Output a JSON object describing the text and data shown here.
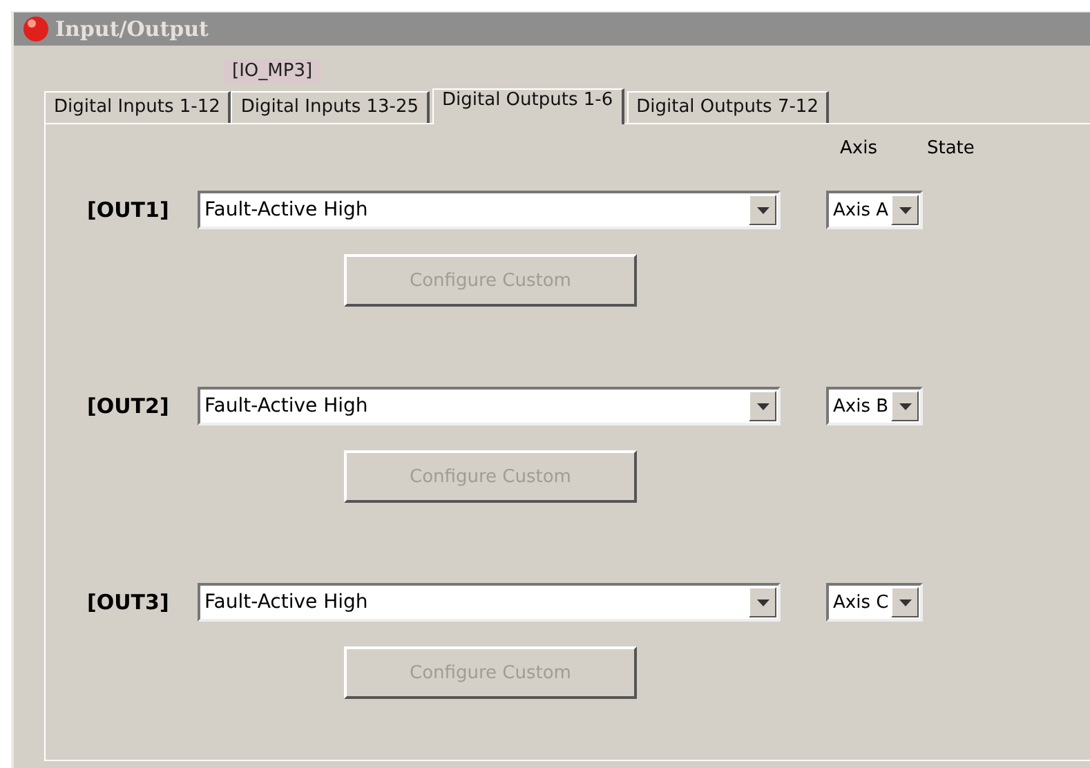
{
  "window": {
    "title": "Input/Output"
  },
  "tooltip": "[IO_MP3]",
  "tabs": [
    {
      "label": "Digital Inputs 1-12",
      "selected": false
    },
    {
      "label": "Digital Inputs 13-25",
      "selected": false
    },
    {
      "label": "Digital Outputs 1-6",
      "selected": true
    },
    {
      "label": "Digital Outputs 7-12",
      "selected": false
    }
  ],
  "column_headers": [
    "Axis",
    "State"
  ],
  "outputs": [
    {
      "label": "[OUT1]",
      "function": "Fault-Active High",
      "axis": "Axis A",
      "button": {
        "label": "Configure Custom",
        "disabled": true
      }
    },
    {
      "label": "[OUT2]",
      "function": "Fault-Active High",
      "axis": "Axis B",
      "button": {
        "label": "Configure Custom",
        "disabled": true
      }
    },
    {
      "label": "[OUT3]",
      "function": "Fault-Active High",
      "axis": "Axis C",
      "button": {
        "label": "Configure Custom",
        "disabled": true
      }
    }
  ]
}
